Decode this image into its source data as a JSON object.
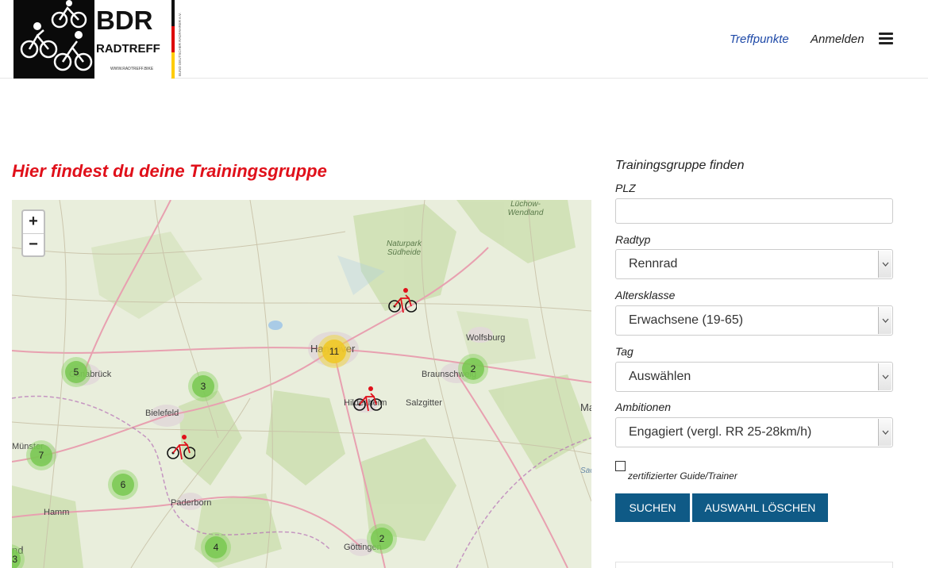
{
  "logo": {
    "brand_top": "BDR",
    "brand_bottom": "RADTREFF",
    "url": "WWW.RADTREFF.BIKE",
    "vertical_text": "BUND DEUTSCHER RADFAHRER e.V."
  },
  "nav": {
    "treffpunkte": "Treffpunkte",
    "login": "Anmelden"
  },
  "main": {
    "title": "Hier findest du deine Trainingsgruppe"
  },
  "map": {
    "zoom_in": "+",
    "zoom_out": "−",
    "labels": {
      "hannover": "Hannover",
      "wolfsburg": "Wolfsburg",
      "braunschweig": "Braunschweig",
      "osnabrueck": "Osnabrück",
      "bielefeld": "Bielefeld",
      "muenster": "Münster",
      "paderborn": "Paderborn",
      "hamm": "Hamm",
      "hildesheim": "Hildesheim",
      "salzgitter": "Salzgitter",
      "goettingen": "Göttingen",
      "park_suedheide": "Naturpark Südheide",
      "wendland": "Lüchow-Wendland",
      "edge_ma": "Ma",
      "edge_sac": "Sac",
      "edge_nd": "nd"
    },
    "clusters": {
      "c_hannover": "11",
      "c_osnabrueck": "5",
      "c_mid": "3",
      "c_braunschweig": "2",
      "c_muenster": "7",
      "c_paderborn": "6",
      "c_south": "4",
      "c_goettingen": "2",
      "c_edge": "3"
    },
    "colors": {
      "cluster_green": "#78c850",
      "cluster_yellow": "#f0c828",
      "bike_red": "#e0101a"
    }
  },
  "form": {
    "title": "Trainingsgruppe finden",
    "plz_label": "PLZ",
    "plz_value": "",
    "radtyp_label": "Radtyp",
    "radtyp_value": "Rennrad",
    "alter_label": "Altersklasse",
    "alter_value": "Erwachsene (19-65)",
    "tag_label": "Tag",
    "tag_value": "Auswählen",
    "ambition_label": "Ambitionen",
    "ambition_value": "Engagiert (vergl. RR 25-28km/h)",
    "guide_label": "zertifizierter Guide/Trainer",
    "search_btn": "SUCHEN",
    "clear_btn": "AUSWAHL LÖSCHEN"
  }
}
